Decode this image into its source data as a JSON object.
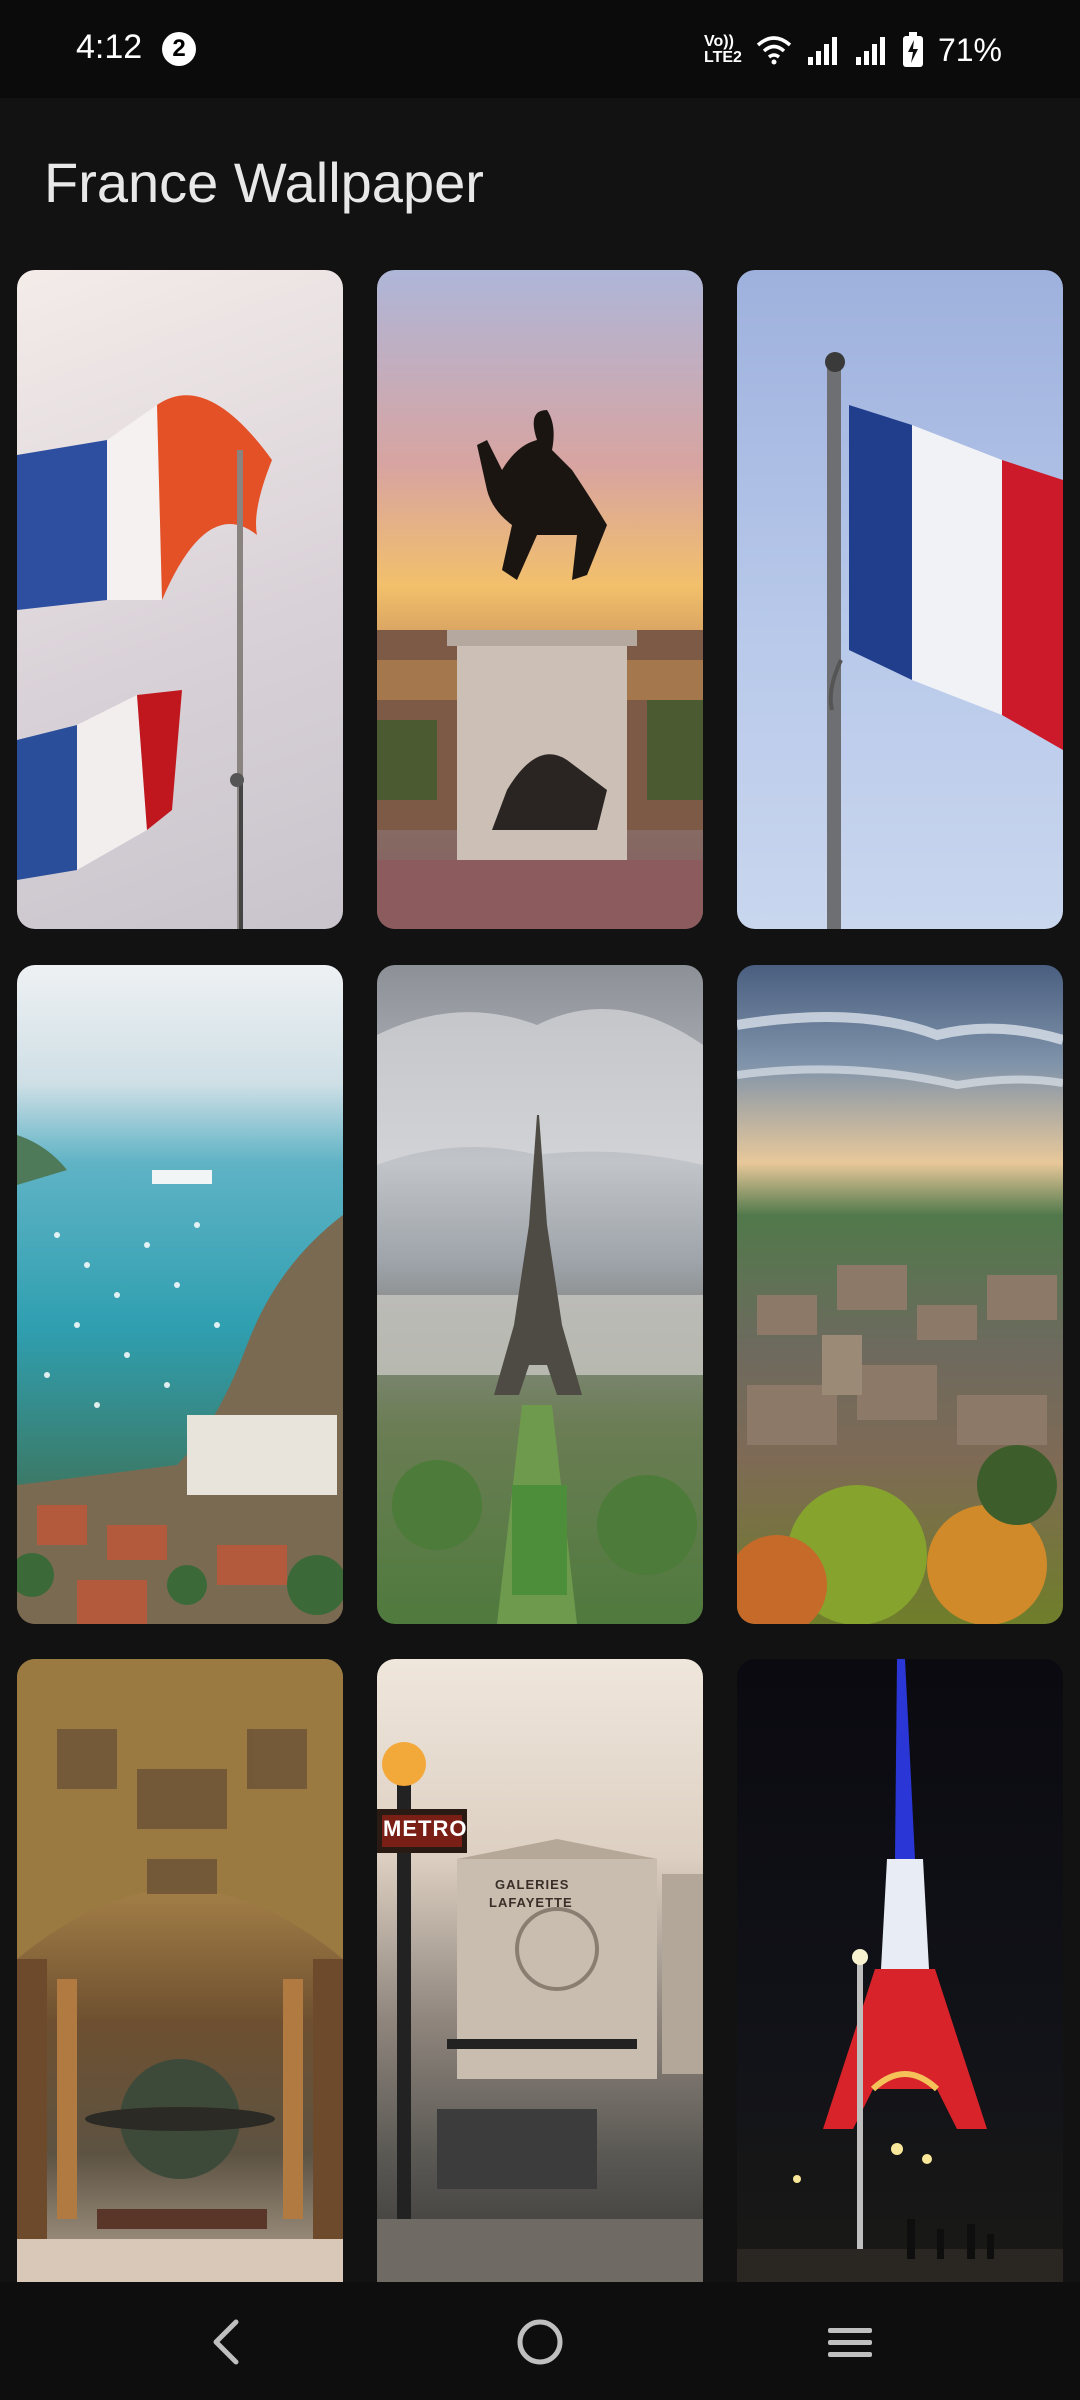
{
  "status_bar": {
    "time": "4:12",
    "notification_count": "2",
    "lte_line1": "Vo))",
    "lte_line2": "LTE2",
    "battery_percent": "71%"
  },
  "app": {
    "title": "France Wallpaper"
  },
  "wallpapers": [
    {
      "subject": "French flags waving"
    },
    {
      "subject": "Louis XIV equestrian statue at sunset"
    },
    {
      "subject": "French flag on pole against blue sky"
    },
    {
      "subject": "Villefranche-sur-Mer coastal bay"
    },
    {
      "subject": "Eiffel Tower aerial view"
    },
    {
      "subject": "Provence hilltop village at dusk"
    },
    {
      "subject": "Palace gallery with globe"
    },
    {
      "subject": "Metro entrance and Galeries Lafayette",
      "signs": [
        "METRO",
        "GALERIES",
        "LAFAYETTE"
      ]
    },
    {
      "subject": "Eiffel Tower lit in blue white red"
    }
  ],
  "nav_bar": {
    "back": "back-icon",
    "home": "home-icon",
    "recents": "recents-icon"
  }
}
